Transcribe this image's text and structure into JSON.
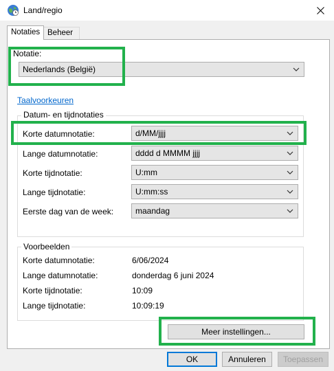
{
  "window": {
    "title": "Land/regio"
  },
  "tabs": [
    {
      "label": "Notaties",
      "active": true
    },
    {
      "label": "Beheer",
      "active": false
    }
  ],
  "notatie": {
    "label": "Notatie:",
    "value": "Nederlands (België)"
  },
  "link": {
    "label": "Taalvoorkeuren"
  },
  "formats": {
    "title": "Datum- en tijdnotaties",
    "short_date": {
      "label": "Korte datumnotatie:",
      "value": "d/MM/jjjj"
    },
    "long_date": {
      "label": "Lange datumnotatie:",
      "value": "dddd d MMMM jjjj"
    },
    "short_time": {
      "label": "Korte tijdnotatie:",
      "value": "U:mm"
    },
    "long_time": {
      "label": "Lange tijdnotatie:",
      "value": "U:mm:ss"
    },
    "first_day": {
      "label": "Eerste dag van de week:",
      "value": "maandag"
    }
  },
  "examples": {
    "title": "Voorbeelden",
    "rows": [
      {
        "label": "Korte datumnotatie:",
        "value": "6/06/2024"
      },
      {
        "label": "Lange datumnotatie:",
        "value": "donderdag 6 juni 2024"
      },
      {
        "label": "Korte tijdnotatie:",
        "value": "10:09"
      },
      {
        "label": "Lange tijdnotatie:",
        "value": "10:09:19"
      }
    ]
  },
  "buttons": {
    "more_settings": "Meer instellingen...",
    "ok": "OK",
    "cancel": "Annuleren",
    "apply": "Toepassen"
  },
  "colors": {
    "highlight": "#22b14c",
    "link": "#0066cc",
    "focus_border": "#0078d7"
  }
}
